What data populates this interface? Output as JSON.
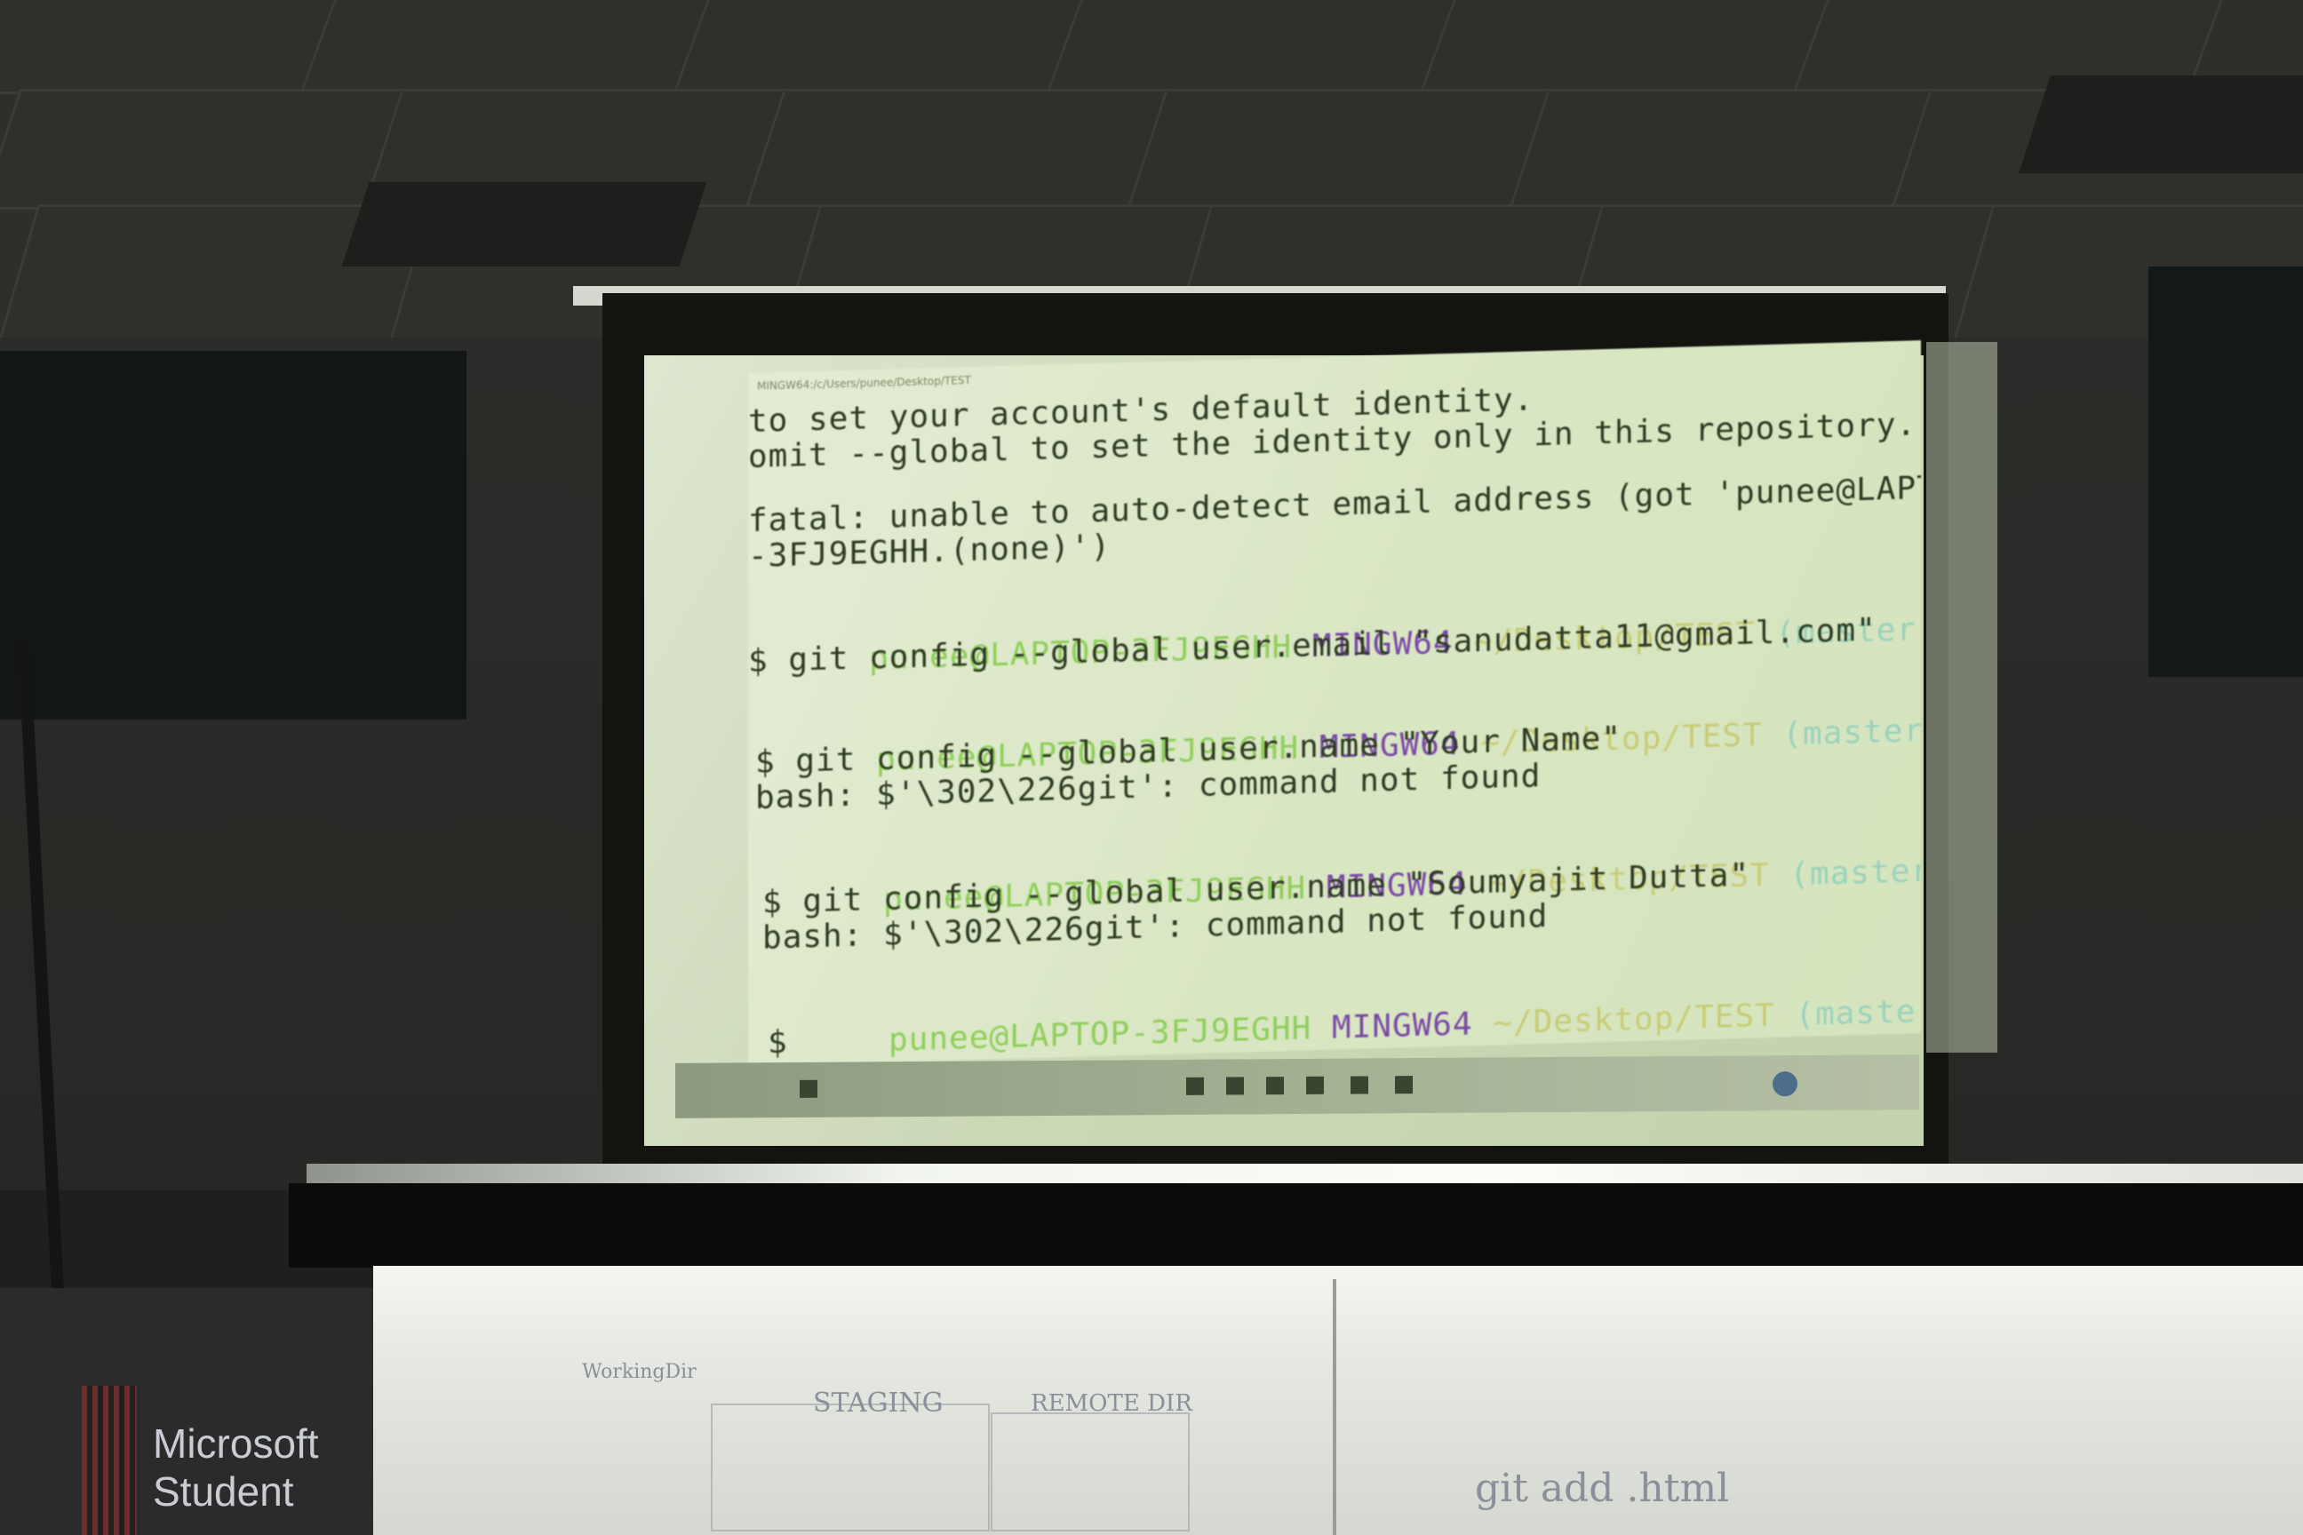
{
  "terminal": {
    "title": "MINGW64:/c/Users/punee/Desktop/TEST",
    "lines": [
      "to set your account's default identity.",
      "omit --global to set the identity only in this repository.",
      "",
      "fatal: unable to auto-detect email address (got 'punee@LAPTOP",
      "-3FJ9EGHH.(none)')"
    ],
    "prompts": [
      {
        "user": "punee@LAPTOP-3FJ9EGHH",
        "shell": "MINGW64",
        "path": "~/Desktop/TEST",
        "branch": "(master)",
        "command": "$ git config --global user.email \"sanudatta11@gmail.com\"",
        "output": ""
      },
      {
        "user": "punee@LAPTOP-3FJ9EGHH",
        "shell": "MINGW64",
        "path": "~/Desktop/TEST",
        "branch": "(master)",
        "command": "$ git config --global user.name \"Your Name\"",
        "output": "bash: $'\\302\\226git': command not found"
      },
      {
        "user": "punee@LAPTOP-3FJ9EGHH",
        "shell": "MINGW64",
        "path": "~/Desktop/TEST",
        "branch": "(master)",
        "command": "$ git config --global user.name \"Soumyajit Dutta\"",
        "output": "bash: $'\\302\\226git': command not found"
      },
      {
        "user": "punee@LAPTOP-3FJ9EGHH",
        "shell": "MINGW64",
        "path": "~/Desktop/TEST",
        "branch": "(master)",
        "command": "$",
        "output": ""
      }
    ]
  },
  "whiteboard": {
    "labels": [
      "WorkingDir",
      "STAGING",
      "REMOTE DIR",
      "git add .html"
    ]
  },
  "banner": {
    "line1": "Microsoft",
    "line2": "Student"
  },
  "colors": {
    "prompt_user": "#8fcf5a",
    "prompt_shell": "#7a4aa6",
    "prompt_path": "#c8cc76",
    "prompt_branch": "#9ad2bc",
    "screen": "#d9e6c3"
  }
}
